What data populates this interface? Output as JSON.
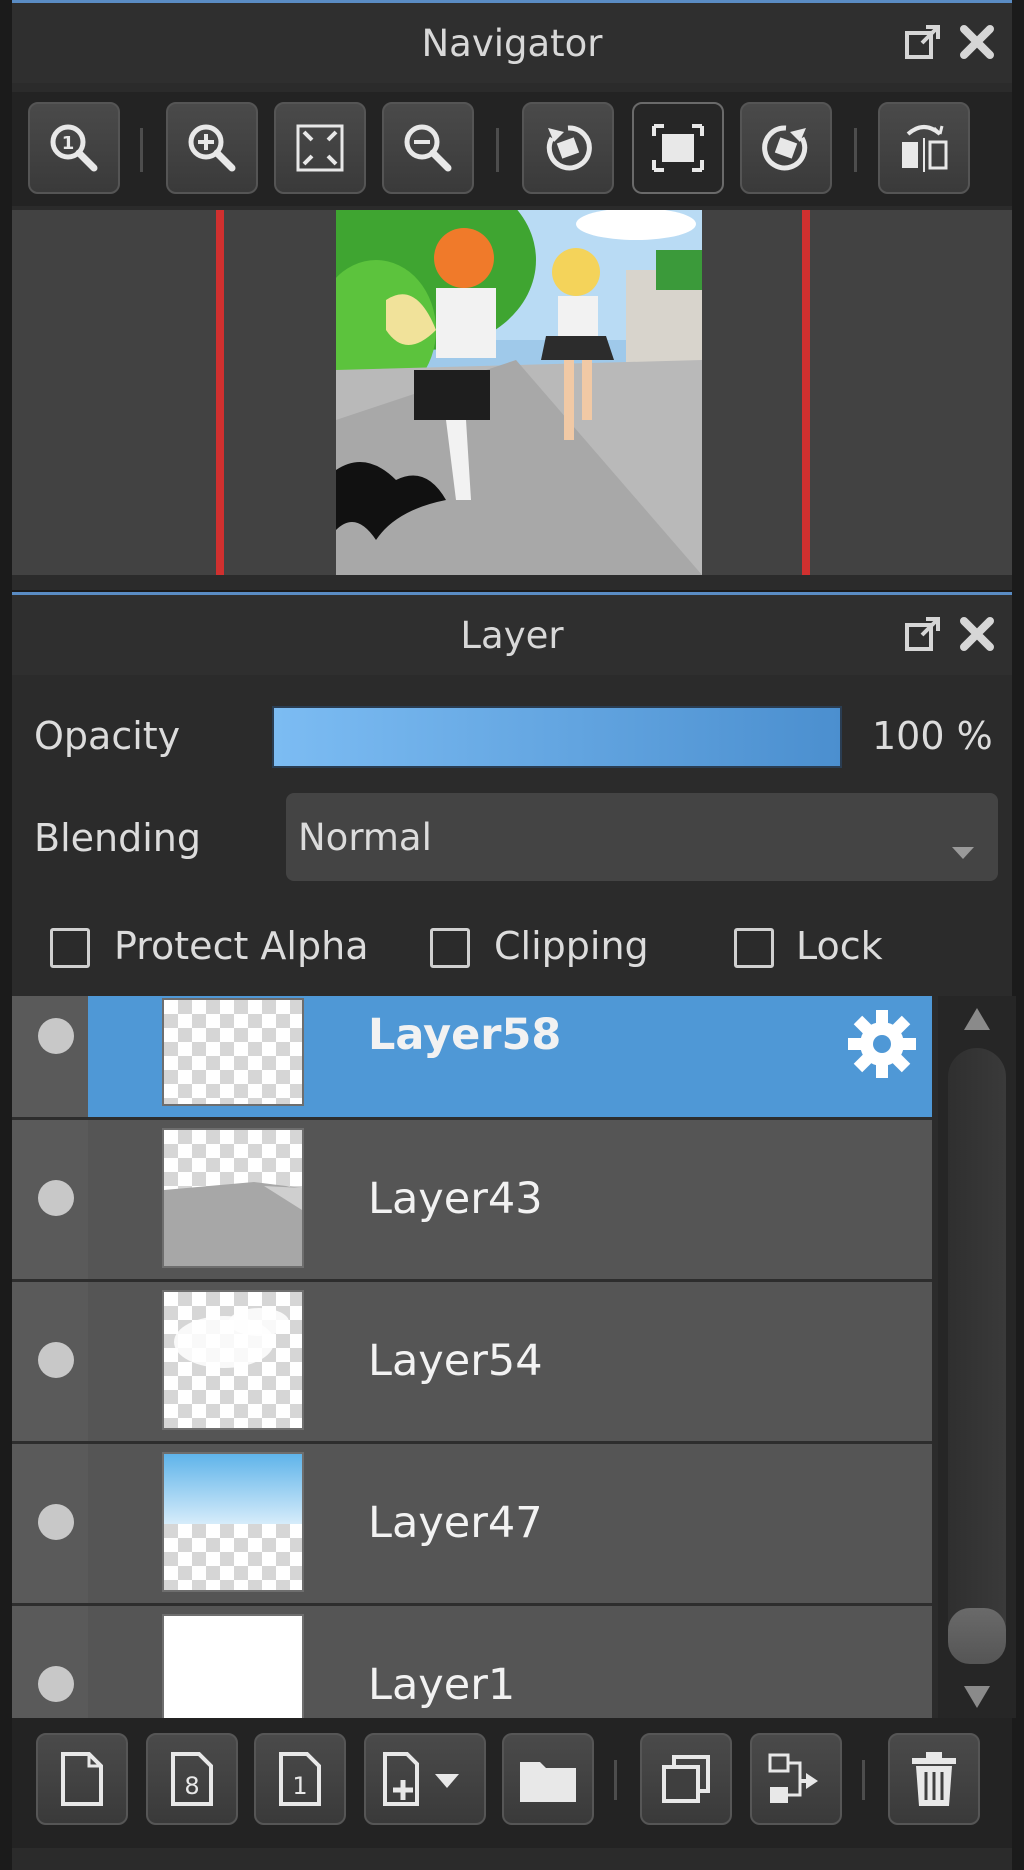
{
  "navigator": {
    "title": "Navigator",
    "toolbar": [
      {
        "icon": "zoom-actual-icon"
      },
      {
        "icon": "zoom-in-icon"
      },
      {
        "icon": "fit-to-window-icon"
      },
      {
        "icon": "zoom-out-icon"
      },
      {
        "icon": "rotate-left-icon"
      },
      {
        "icon": "reset-rotation-icon"
      },
      {
        "icon": "rotate-right-icon"
      },
      {
        "icon": "flip-horizontal-icon"
      }
    ]
  },
  "layer_panel": {
    "title": "Layer",
    "opacity_label": "Opacity",
    "opacity_value": "100 %",
    "opacity_fraction": 1.0,
    "blending_label": "Blending",
    "blending_value": "Normal",
    "checkboxes": {
      "protect_alpha": "Protect Alpha",
      "clipping": "Clipping",
      "lock": "Lock"
    },
    "layers": [
      {
        "name": "Layer58",
        "selected": true
      },
      {
        "name": "Layer43",
        "selected": false
      },
      {
        "name": "Layer54",
        "selected": false
      },
      {
        "name": "Layer47",
        "selected": false
      },
      {
        "name": "Layer1",
        "selected": false
      }
    ],
    "bottom_toolbar": [
      {
        "icon": "new-layer-icon"
      },
      {
        "icon": "new-8bit-layer-icon"
      },
      {
        "icon": "new-1bit-layer-icon"
      },
      {
        "icon": "add-layer-menu-icon"
      },
      {
        "icon": "new-folder-icon"
      },
      {
        "icon": "duplicate-layer-icon"
      },
      {
        "icon": "merge-down-icon"
      },
      {
        "icon": "delete-layer-icon"
      }
    ]
  },
  "colors": {
    "accent": "#5a8cc4",
    "selected_row": "#4f98d6",
    "opacity_bar": "#5aa3e4",
    "canvas_border": "#d0302f"
  }
}
